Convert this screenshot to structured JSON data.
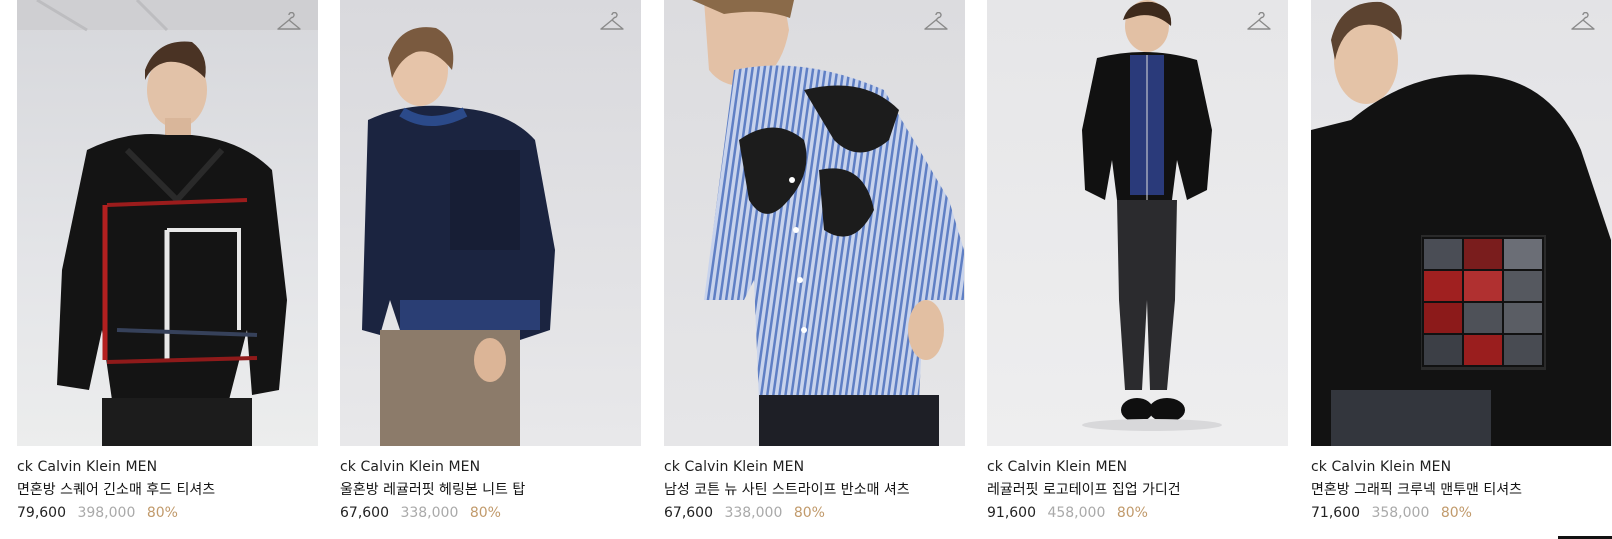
{
  "products": [
    {
      "brand": "ck Calvin Klein MEN",
      "name": "면혼방 스퀘어 긴소매 후드 티셔츠",
      "price": "79,600",
      "original_price": "398,000",
      "discount": "80%"
    },
    {
      "brand": "ck Calvin Klein MEN",
      "name": "울혼방 레귤러핏 헤링본 니트 탑",
      "price": "67,600",
      "original_price": "338,000",
      "discount": "80%"
    },
    {
      "brand": "ck Calvin Klein MEN",
      "name": "남성 코튼 뉴 사틴 스트라이프 반소매 셔츠",
      "price": "67,600",
      "original_price": "338,000",
      "discount": "80%"
    },
    {
      "brand": "ck Calvin Klein MEN",
      "name": "레귤러핏 로고테이프 집업 가디건",
      "price": "91,600",
      "original_price": "458,000",
      "discount": "80%"
    },
    {
      "brand": "ck Calvin Klein MEN",
      "name": "면혼방 그래픽 크루넥 맨투맨 티셔츠",
      "price": "71,600",
      "original_price": "358,000",
      "discount": "80%"
    }
  ],
  "icons": {
    "wishlist": "hanger-icon"
  },
  "colors": {
    "discount": "#c19a6b",
    "original_price": "#a9a9a9",
    "price": "#222222"
  }
}
